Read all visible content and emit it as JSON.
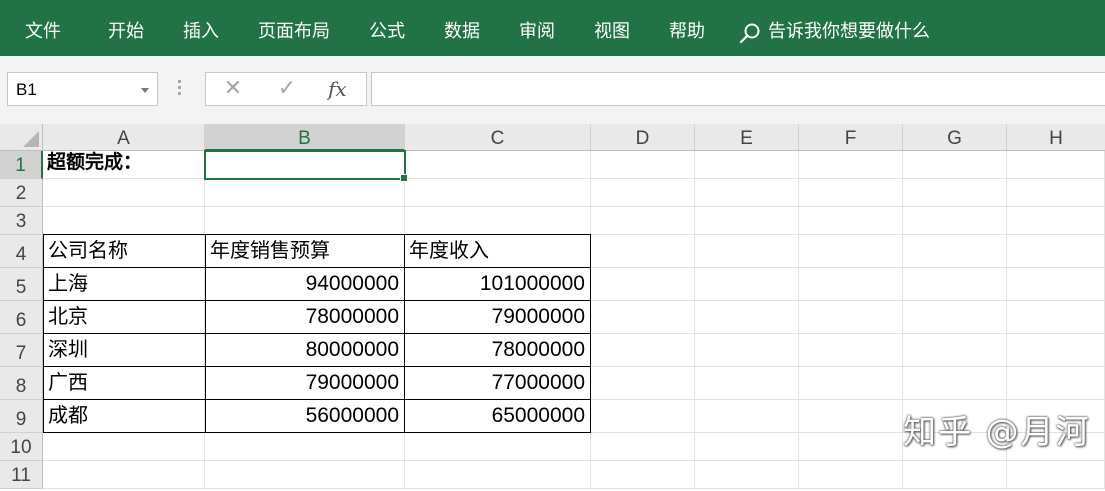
{
  "ribbon": {
    "tabs": [
      "文件",
      "开始",
      "插入",
      "页面布局",
      "公式",
      "数据",
      "审阅",
      "视图",
      "帮助"
    ],
    "tell_me": "告诉我你想要做什么",
    "icons": [
      "search-icon"
    ]
  },
  "formula_bar": {
    "name_box": "B1",
    "cancel_glyph": "✕",
    "enter_glyph": "✓",
    "fx_label": "fx",
    "formula_value": ""
  },
  "columns": [
    "A",
    "B",
    "C",
    "D",
    "E",
    "F",
    "G",
    "H"
  ],
  "rows": [
    "1",
    "2",
    "3",
    "4",
    "5",
    "6",
    "7",
    "8",
    "9",
    "10",
    "11"
  ],
  "selected_cell": "B1",
  "cells": {
    "a1": "超额完成：",
    "table_headers": [
      "公司名称",
      "年度销售预算",
      "年度收入"
    ],
    "table_rows": [
      [
        "上海",
        "94000000",
        "101000000"
      ],
      [
        "北京",
        "78000000",
        "79000000"
      ],
      [
        "深圳",
        "80000000",
        "78000000"
      ],
      [
        "广西",
        "79000000",
        "77000000"
      ],
      [
        "成都",
        "56000000",
        "65000000"
      ]
    ]
  },
  "watermark": "知乎 @月河",
  "colors": {
    "ribbon": "#217346",
    "selection": "#217346"
  }
}
